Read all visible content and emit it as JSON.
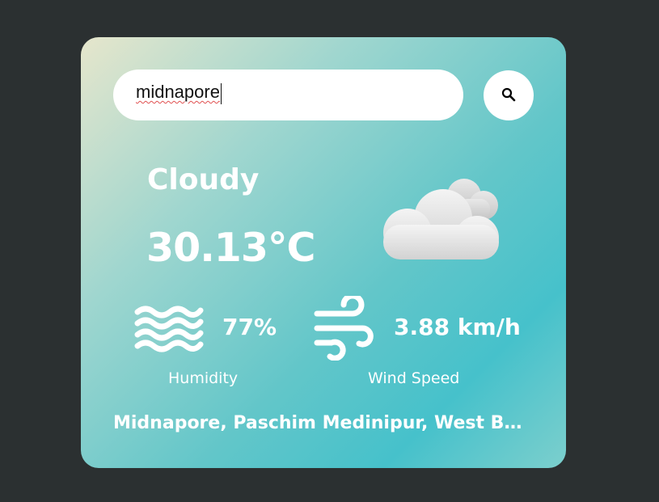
{
  "search": {
    "value": "midnapore",
    "button_icon": "search-icon"
  },
  "weather": {
    "condition": "Cloudy",
    "temperature": "30.13°C",
    "condition_icon": "cloud-icon"
  },
  "humidity": {
    "icon": "humidity-waves-icon",
    "value": "77%",
    "label": "Humidity"
  },
  "wind": {
    "icon": "wind-icon",
    "value": "3.88 km/h",
    "label": "Wind Speed"
  },
  "location": "Midnapore, Paschim Medinipur, West Bengal",
  "colors": {
    "background": "#2b3031",
    "card_gradient_start": "#e6e6cc",
    "card_gradient_end": "#46c1cb",
    "text": "#ffffff"
  }
}
